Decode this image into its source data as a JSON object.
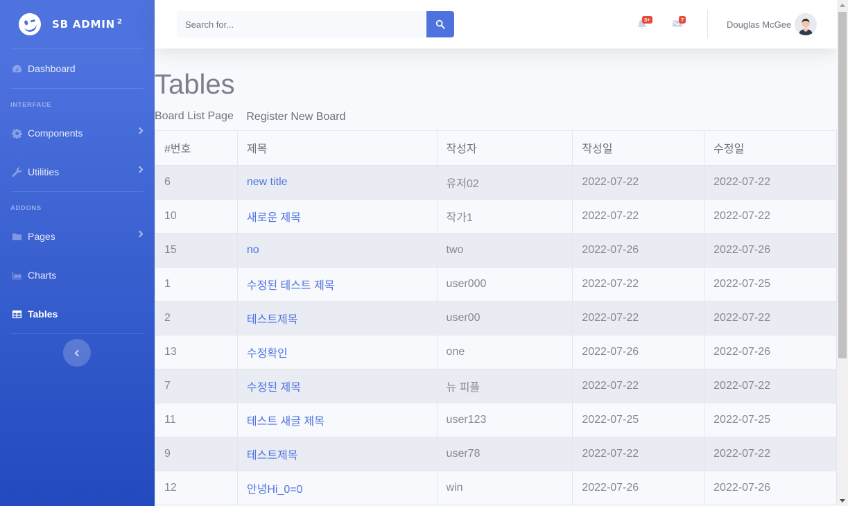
{
  "brand": {
    "name": "SB ADMIN",
    "sup": "2",
    "icon": "laugh-wink-icon"
  },
  "sidebar": {
    "dashboard": "Dashboard",
    "heading_interface": "INTERFACE",
    "components": "Components",
    "utilities": "Utilities",
    "heading_addons": "ADDONS",
    "pages": "Pages",
    "charts": "Charts",
    "tables": "Tables",
    "active": "Tables"
  },
  "topbar": {
    "search_placeholder": "Search for...",
    "alerts_badge": "3+",
    "messages_badge": "7",
    "user_name": "Douglas McGee"
  },
  "page": {
    "title": "Tables",
    "link_list": "Board List Page",
    "link_register": "Register New Board"
  },
  "table": {
    "headers": [
      "#번호",
      "제목",
      "작성자",
      "작성일",
      "수정일"
    ],
    "rows": [
      [
        "6",
        "new title",
        "유저02",
        "2022-07-22",
        "2022-07-22"
      ],
      [
        "10",
        "새로운 제목",
        "작가1",
        "2022-07-22",
        "2022-07-22"
      ],
      [
        "15",
        "no",
        "two",
        "2022-07-26",
        "2022-07-26"
      ],
      [
        "1",
        "수정된 테스트 제목",
        "user000",
        "2022-07-22",
        "2022-07-25"
      ],
      [
        "2",
        "테스트제목",
        "user00",
        "2022-07-22",
        "2022-07-22"
      ],
      [
        "13",
        "수정확인",
        "one",
        "2022-07-26",
        "2022-07-26"
      ],
      [
        "7",
        "수정된 제목",
        "뉴 피플",
        "2022-07-22",
        "2022-07-22"
      ],
      [
        "11",
        "테스트 새글 제목",
        "user123",
        "2022-07-25",
        "2022-07-25"
      ],
      [
        "9",
        "테스트제목",
        "user78",
        "2022-07-22",
        "2022-07-22"
      ],
      [
        "12",
        "안녕Hi_0=0",
        "win",
        "2022-07-26",
        "2022-07-26"
      ]
    ]
  },
  "colors": {
    "primary": "#4e73df",
    "danger": "#e74a3b",
    "text": "#858796"
  }
}
